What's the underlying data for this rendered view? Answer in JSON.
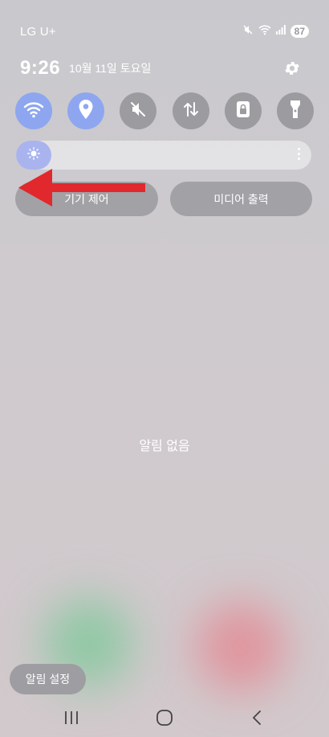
{
  "status_bar": {
    "carrier": "LG U+",
    "battery": "87",
    "icons": [
      "mute-icon",
      "wifi-icon",
      "signal-icon"
    ]
  },
  "header": {
    "time": "9:26",
    "date": "10월 11일 토요일",
    "settings_icon": "gear-icon"
  },
  "quick_settings": {
    "tiles": [
      {
        "name": "wifi",
        "icon": "wifi-icon",
        "state": "on"
      },
      {
        "name": "location",
        "icon": "location-icon",
        "state": "on"
      },
      {
        "name": "sound",
        "icon": "mute-icon",
        "state": "off"
      },
      {
        "name": "mobile-data",
        "icon": "data-arrows-icon",
        "state": "off"
      },
      {
        "name": "secure-folder",
        "icon": "lock-icon",
        "state": "off"
      },
      {
        "name": "flashlight",
        "icon": "flashlight-icon",
        "state": "off"
      }
    ],
    "brightness_level": 0.05
  },
  "buttons": {
    "device_control": "기기 제어",
    "media_output": "미디어 출력"
  },
  "notifications": {
    "empty_text": "알림 없음",
    "settings_label": "알림 설정"
  },
  "colors": {
    "tile_on": "#8ea6f0",
    "tile_off": "#9c9ca0",
    "arrow": "#e0282d"
  }
}
